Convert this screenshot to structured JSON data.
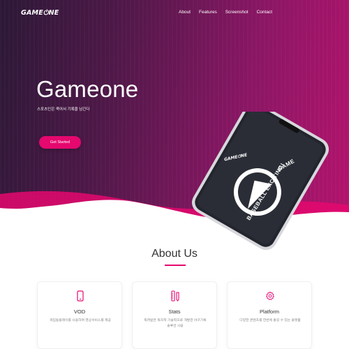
{
  "nav": {
    "logo": "GAME⏻NE",
    "items": [
      {
        "label": "About"
      },
      {
        "label": "Features"
      },
      {
        "label": "Screenshot"
      },
      {
        "label": "Contact"
      }
    ]
  },
  "hero": {
    "title": "Gameone",
    "subtitle": "스포츠인은 쿡어서 기록을 남긴다",
    "cta": "Get Started"
  },
  "phone": {
    "logo": "GAME⏻NE",
    "badge_text": "BASEBALL EXCITING!",
    "badge_text_2": "GAME"
  },
  "about": {
    "title": "About Us",
    "cards": [
      {
        "icon": "mobile-icon",
        "title": "VOD",
        "desc": "게임동플레이를 사용하여 영상서비스를 제공"
      },
      {
        "icon": "pencil-ruler-icon",
        "title": "Stats",
        "desc": "독려받은 독자적 기술력으로 개발한 야구기록 솔루션 사용"
      },
      {
        "icon": "gear-icon",
        "title": "Platform",
        "desc": "다양한 콘텐츠를 한번에 즐길 수 있는 플랫폼"
      }
    ]
  },
  "colors": {
    "accent": "#e5086e",
    "hero_dark": "#2b1836",
    "hero_light": "#b3136c"
  }
}
